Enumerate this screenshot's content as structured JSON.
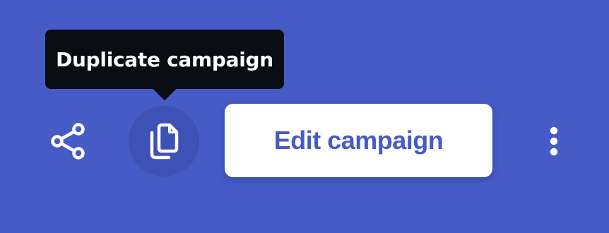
{
  "tooltip": {
    "text": "Duplicate campaign"
  },
  "actions": {
    "share_icon": "share-icon",
    "duplicate_icon": "copy-icon",
    "edit_label": "Edit campaign",
    "more_icon": "more-vertical-icon"
  },
  "colors": {
    "background": "#465bc6",
    "tooltip_background": "#0a0c14",
    "active_icon_background": "#3e51b4",
    "edit_button_text": "#465bc6",
    "edit_button_background": "#ffffff"
  }
}
